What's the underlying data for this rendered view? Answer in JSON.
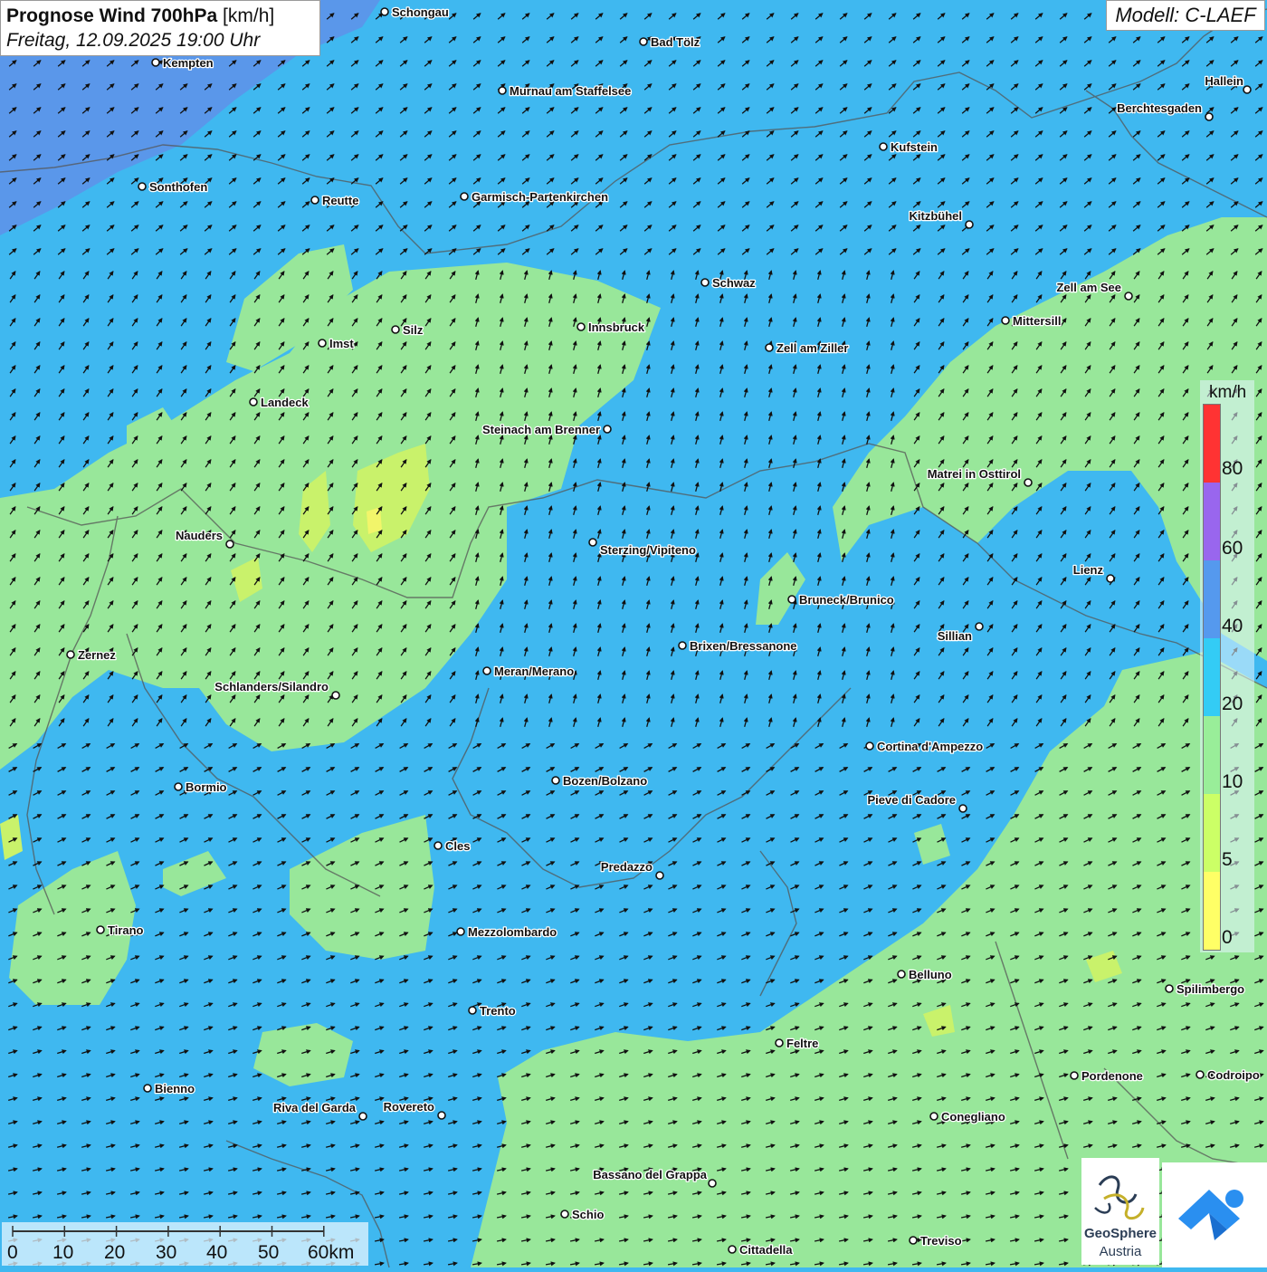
{
  "title": {
    "main": "Prognose Wind 700hPa",
    "unit": "[km/h]",
    "datetime": "Freitag, 12.09.2025 19:00 Uhr"
  },
  "model_label": "Modell: C-LAEF",
  "legend": {
    "unit": "km/h",
    "labels": [
      "80",
      "60",
      "40",
      "20",
      "10",
      "5",
      "0"
    ],
    "colors": {
      "0": "#ffff66",
      "5": "#ccff66",
      "10": "#99ee99",
      "20": "#33ccf5",
      "40": "#5599ee",
      "60": "#9966ee",
      "80": "#ff3333"
    }
  },
  "scale": {
    "labels": [
      "0",
      "10",
      "20",
      "30",
      "40",
      "50",
      "60km"
    ]
  },
  "cities": [
    {
      "name": "Schongau"
    },
    {
      "name": "Bad Tölz"
    },
    {
      "name": "Kempten"
    },
    {
      "name": "Murnau am Staffelsee"
    },
    {
      "name": "Hallein"
    },
    {
      "name": "Berchtesgaden"
    },
    {
      "name": "Kufstein"
    },
    {
      "name": "Sonthofen"
    },
    {
      "name": "Reutte"
    },
    {
      "name": "Garmisch-Partenkirchen"
    },
    {
      "name": "Kitzbühel"
    },
    {
      "name": "Schwaz"
    },
    {
      "name": "Zell am See"
    },
    {
      "name": "Mittersill"
    },
    {
      "name": "Innsbruck"
    },
    {
      "name": "Silz"
    },
    {
      "name": "Imst"
    },
    {
      "name": "Zell am Ziller"
    },
    {
      "name": "Landeck"
    },
    {
      "name": "Steinach am Brenner"
    },
    {
      "name": "Matrei in Osttirol"
    },
    {
      "name": "Nauders"
    },
    {
      "name": "Sterzing/Vipiteno"
    },
    {
      "name": "Lienz"
    },
    {
      "name": "Bruneck/Brunico"
    },
    {
      "name": "Sillian"
    },
    {
      "name": "Zernez"
    },
    {
      "name": "Brixen/Bressanone"
    },
    {
      "name": "Meran/Merano"
    },
    {
      "name": "Schlanders/Silandro"
    },
    {
      "name": "Cortina d'Ampezzo"
    },
    {
      "name": "Bozen/Bolzano"
    },
    {
      "name": "Bormio"
    },
    {
      "name": "Pieve di Cadore"
    },
    {
      "name": "Cles"
    },
    {
      "name": "Predazzo"
    },
    {
      "name": "Tirano"
    },
    {
      "name": "Mezzolombardo"
    },
    {
      "name": "Belluno"
    },
    {
      "name": "Spilimbergo"
    },
    {
      "name": "Trento"
    },
    {
      "name": "Feltre"
    },
    {
      "name": "Pordenone"
    },
    {
      "name": "Codroipo"
    },
    {
      "name": "Bienno"
    },
    {
      "name": "Riva del Garda"
    },
    {
      "name": "Rovereto"
    },
    {
      "name": "Conegliano"
    },
    {
      "name": "Bassano del Grappa"
    },
    {
      "name": "Schio"
    },
    {
      "name": "Treviso"
    },
    {
      "name": "Cittadella"
    }
  ],
  "logos": {
    "geosphere": {
      "line1": "GeoSphere",
      "line2": "Austria"
    }
  }
}
